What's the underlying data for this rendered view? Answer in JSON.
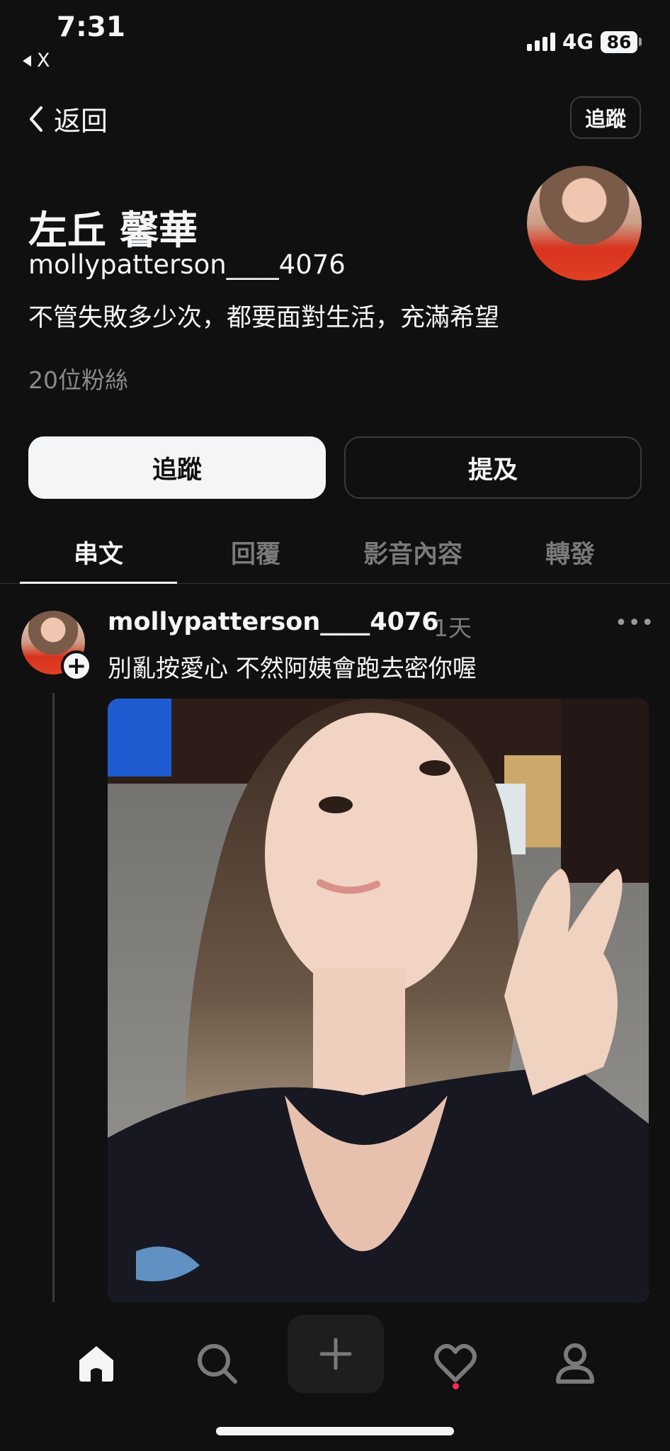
{
  "status_bar": {
    "time": "7:31",
    "back_app": "X",
    "network": "4G",
    "battery": "86"
  },
  "nav": {
    "back_label": "返回",
    "follow_label": "追蹤"
  },
  "profile": {
    "display_name": "左丘 馨華",
    "username": "mollypatterson____4076",
    "bio": "不管失敗多少次，都要面對生活，充滿希望",
    "followers": "20位粉絲"
  },
  "actions": {
    "follow": "追蹤",
    "mention": "提及"
  },
  "tabs": [
    {
      "label": "串文",
      "active": true
    },
    {
      "label": "回覆",
      "active": false
    },
    {
      "label": "影音內容",
      "active": false
    },
    {
      "label": "轉發",
      "active": false
    }
  ],
  "post": {
    "username": "mollypatterson____4076",
    "time": "1天",
    "text": "別亂按愛心 不然阿姨會跑去密你喔"
  },
  "bottom_nav": {
    "items": [
      "home-icon",
      "search-icon",
      "create-icon",
      "heart-icon",
      "profile-icon"
    ],
    "active": "home-icon",
    "notification_dot_color": "#fe2a52"
  }
}
